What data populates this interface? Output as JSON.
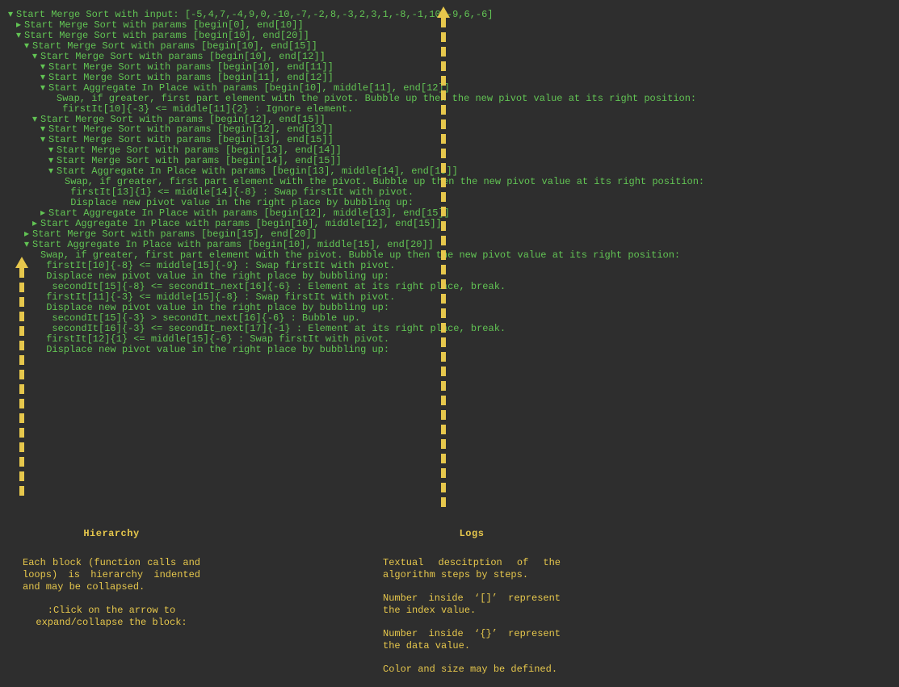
{
  "tree": [
    {
      "indent": 0,
      "arrow": "down",
      "text": "Start Merge Sort with input: [-5,4,7,-4,9,0,-10,-7,-2,8,-3,2,3,1,-8,-1,10,-9,6,-6]"
    },
    {
      "indent": 1,
      "arrow": "right",
      "text": "Start Merge Sort with params [begin[0], end[10]]"
    },
    {
      "indent": 1,
      "arrow": "down",
      "text": "Start Merge Sort with params [begin[10], end[20]]"
    },
    {
      "indent": 2,
      "arrow": "down",
      "text": "Start Merge Sort with params [begin[10], end[15]]"
    },
    {
      "indent": 3,
      "arrow": "down",
      "text": "Start Merge Sort with params [begin[10], end[12]]"
    },
    {
      "indent": 4,
      "arrow": "down",
      "text": "Start Merge Sort with params [begin[10], end[11]]"
    },
    {
      "indent": 4,
      "arrow": "down",
      "text": "Start Merge Sort with params [begin[11], end[12]]"
    },
    {
      "indent": 4,
      "arrow": "down",
      "text": "Start Aggregate In Place with params [begin[10], middle[11], end[12]]"
    },
    {
      "indent": 5,
      "arrow": "none",
      "text": "Swap, if greater, first part element with the pivot. Bubble up then the new pivot value at its right position:"
    },
    {
      "indent": 5,
      "arrow": "none",
      "text": " firstIt[10]{-3} <= middle[11]{2} : Ignore element."
    },
    {
      "indent": 3,
      "arrow": "down",
      "text": "Start Merge Sort with params [begin[12], end[15]]"
    },
    {
      "indent": 4,
      "arrow": "down",
      "text": "Start Merge Sort with params [begin[12], end[13]]"
    },
    {
      "indent": 4,
      "arrow": "down",
      "text": "Start Merge Sort with params [begin[13], end[15]]"
    },
    {
      "indent": 5,
      "arrow": "down",
      "text": "Start Merge Sort with params [begin[13], end[14]]"
    },
    {
      "indent": 5,
      "arrow": "down",
      "text": "Start Merge Sort with params [begin[14], end[15]]"
    },
    {
      "indent": 5,
      "arrow": "down",
      "text": "Start Aggregate In Place with params [begin[13], middle[14], end[15]]"
    },
    {
      "indent": 6,
      "arrow": "none",
      "text": "Swap, if greater, first part element with the pivot. Bubble up then the new pivot value at its right position:"
    },
    {
      "indent": 6,
      "arrow": "none",
      "text": " firstIt[13]{1} <= middle[14]{-8} : Swap firstIt with pivot."
    },
    {
      "indent": 6,
      "arrow": "none",
      "text": " Displace new pivot value in the right place by bubbling up:"
    },
    {
      "indent": 4,
      "arrow": "right",
      "text": "Start Aggregate In Place with params [begin[12], middle[13], end[15]]"
    },
    {
      "indent": 3,
      "arrow": "right",
      "text": "Start Aggregate In Place with params [begin[10], middle[12], end[15]]"
    },
    {
      "indent": 2,
      "arrow": "right",
      "text": "Start Merge Sort with params [begin[15], end[20]]"
    },
    {
      "indent": 2,
      "arrow": "down",
      "text": "Start Aggregate In Place with params [begin[10], middle[15], end[20]]"
    },
    {
      "indent": 3,
      "arrow": "none",
      "text": "Swap, if greater, first part element with the pivot. Bubble up then the new pivot value at its right position:"
    },
    {
      "indent": 3,
      "arrow": "none",
      "text": " firstIt[10]{-8} <= middle[15]{-9} : Swap firstIt with pivot."
    },
    {
      "indent": 3,
      "arrow": "none",
      "text": " Displace new pivot value in the right place by bubbling up:"
    },
    {
      "indent": 3,
      "arrow": "none",
      "text": "  secondIt[15]{-8} <= secondIt_next[16]{-6} : Element at its right place, break."
    },
    {
      "indent": 3,
      "arrow": "none",
      "text": " firstIt[11]{-3} <= middle[15]{-8} : Swap firstIt with pivot."
    },
    {
      "indent": 3,
      "arrow": "none",
      "text": " Displace new pivot value in the right place by bubbling up:"
    },
    {
      "indent": 3,
      "arrow": "none",
      "text": "  secondIt[15]{-3} > secondIt_next[16]{-6} : Bubble up."
    },
    {
      "indent": 3,
      "arrow": "none",
      "text": "  secondIt[16]{-3} <= secondIt_next[17]{-1} : Element at its right place, break."
    },
    {
      "indent": 3,
      "arrow": "none",
      "text": " firstIt[12]{1} <= middle[15]{-6} : Swap firstIt with pivot."
    },
    {
      "indent": 3,
      "arrow": "none",
      "text": " Displace new pivot value in the right place by bubbling up:"
    }
  ],
  "arrows": {
    "left_dashes": 16,
    "right_dashes": 34
  },
  "info": {
    "hierarchy": {
      "title": "Hierarchy",
      "desc": "Each block (function calls and loops) is hierarchy indented and may be collapsed.",
      "sub": ":Click on the arrow to expand/collapse the block:"
    },
    "logs": {
      "title": "Logs",
      "p1": "Textual descitption of the algorithm steps by steps.",
      "p2": "Number inside ‘[]’ represent the index value.",
      "p3": "Number inside ‘{}’ represent the data value.",
      "p4": "Color and size may be defined."
    }
  }
}
